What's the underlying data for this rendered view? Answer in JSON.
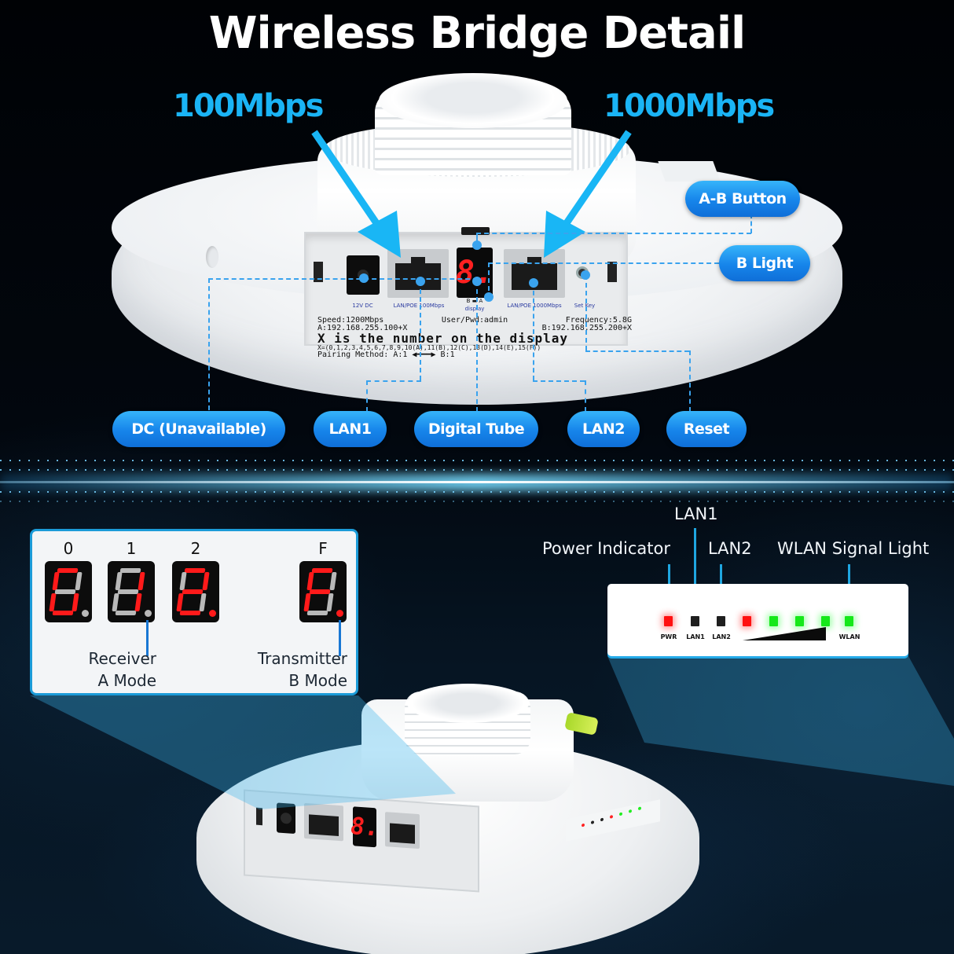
{
  "title": "Wireless Bridge Detail",
  "speeds": {
    "left": "100Mbps",
    "right": "1000Mbps"
  },
  "callouts_right": {
    "ab_button": "A-B Button",
    "b_light": "B Light"
  },
  "callouts_bottom": [
    {
      "id": "dc",
      "label": "DC (Unavailable)"
    },
    {
      "id": "lan1",
      "label": "LAN1"
    },
    {
      "id": "digital_tube",
      "label": "Digital Tube"
    },
    {
      "id": "lan2",
      "label": "LAN2"
    },
    {
      "id": "reset",
      "label": "Reset"
    }
  ],
  "device_display": "8.",
  "bottom_display": "8.",
  "port_labels": [
    "12V DC",
    "LAN/POE 100Mbps",
    "display",
    "LAN/POE 1000Mbps",
    "Set Key"
  ],
  "display_marker": "B ▬ A",
  "sticker": {
    "speed": "Speed:1200Mbps",
    "user": "User/Pwd:admin",
    "frequency": "Frequency:5.8G",
    "ip_a": "A:192.168.255.100+X",
    "ip_b": "B:192.168.255.200+X",
    "x_rule": "X is the number on the display",
    "x_values": "X=(0,1,2,3,4,5,6,7,8,9,10(A),11(B),12(C),13(D),14(E),15(F))",
    "pairing": "Pairing Method: A:1 ◀━━━▶ B:1"
  },
  "segment_panel": {
    "digits": [
      {
        "label": "0",
        "segments": {
          "a": true,
          "b": false,
          "c": true,
          "d": true,
          "e": true,
          "f": true,
          "g": false
        },
        "dp": false
      },
      {
        "label": "1",
        "segments": {
          "a": false,
          "b": true,
          "c": true,
          "d": false,
          "e": false,
          "f": false,
          "g": false
        },
        "dp": false
      },
      {
        "label": "2",
        "segments": {
          "a": true,
          "b": true,
          "c": false,
          "d": true,
          "e": true,
          "f": false,
          "g": true
        },
        "dp": true
      },
      {
        "label": "F",
        "segments": {
          "a": true,
          "b": false,
          "c": false,
          "d": false,
          "e": true,
          "f": true,
          "g": true
        },
        "dp": true
      }
    ],
    "receiver_caption": [
      "Receiver",
      "A Mode"
    ],
    "transmitter_caption": [
      "Transmitter",
      "B Mode"
    ]
  },
  "led_panel": {
    "annotations": {
      "power": "Power Indicator",
      "lan1": "LAN1",
      "lan2": "LAN2",
      "wlan": "WLAN Signal Light"
    },
    "leds": [
      {
        "name": "pwr",
        "state": "red",
        "label": "PWR"
      },
      {
        "name": "lan1",
        "state": "off",
        "label": "LAN1"
      },
      {
        "name": "lan2",
        "state": "off",
        "label": "LAN2"
      },
      {
        "name": "signal-1",
        "state": "red",
        "label": ""
      },
      {
        "name": "signal-2",
        "state": "green",
        "label": ""
      },
      {
        "name": "signal-3",
        "state": "green",
        "label": ""
      },
      {
        "name": "signal-4",
        "state": "green",
        "label": ""
      },
      {
        "name": "wlan",
        "state": "green",
        "label": "WLAN"
      }
    ]
  },
  "colors": {
    "accent_blue": "#1ab4f5",
    "pill_blue": "#1684ea",
    "led_red": "#ff1010",
    "led_green": "#16e81a",
    "segment_red": "#ff1a1a"
  }
}
